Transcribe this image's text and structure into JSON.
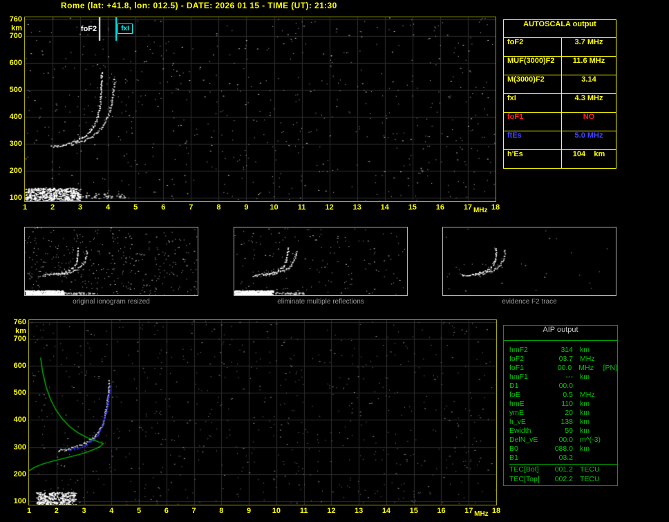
{
  "title": "Rome (lat: +41.8, lon: 012.5) - DATE: 2026 01 15 - TIME (UT): 21:30",
  "colors": {
    "background": "#000000",
    "title": "#ffff00",
    "plot_border": "#a8a800",
    "grid": "#2e2e2e",
    "axis": "#ffff00",
    "yellow": "#ffff00",
    "red": "#ff2222",
    "blue": "#4444ff",
    "cyan": "#00ffff",
    "trace_white": "#ffffff",
    "trace_blue": "#3232ff",
    "profile_green": "#00b400",
    "autoscala_border": "#ffff00",
    "aip_border": "#00a000",
    "aip_text": "#00cc00",
    "aip_title": "#c8c8c8",
    "caption": "#9a9a9a",
    "thumb_border": "#b4b4b4"
  },
  "autoscala_table": {
    "title": "AUTOSCALA output",
    "rows": [
      {
        "label": "foF2",
        "value": "3.7 MHz",
        "color": "yellow"
      },
      {
        "label": "MUF(3000)F2",
        "value": "11.6 MHz",
        "color": "yellow"
      },
      {
        "label": "M(3000)F2",
        "value": "3.14",
        "color": "yellow"
      },
      {
        "label": "fxI",
        "value": "4.3 MHz",
        "color": "yellow"
      },
      {
        "label": "foF1",
        "value": "NO",
        "color": "red"
      },
      {
        "label": "ftEs",
        "value": "5.0 MHz",
        "color": "blue"
      },
      {
        "label": "h'Es",
        "value": "104    km",
        "color": "yellow"
      }
    ]
  },
  "aip_table": {
    "title": "AIP output",
    "rows": [
      {
        "name": "hmF2",
        "value": "314",
        "unit": "km",
        "extra": ""
      },
      {
        "name": "foF2",
        "value": "03.7",
        "unit": "MHz",
        "extra": ""
      },
      {
        "name": "foF1",
        "value": "00.0",
        "unit": "MHz",
        "extra": "[PN]"
      },
      {
        "name": "hmF1",
        "value": "---",
        "unit": "km",
        "extra": ""
      },
      {
        "name": "D1",
        "value": "00.0",
        "unit": "",
        "extra": ""
      },
      {
        "name": "foE",
        "value": "0.5",
        "unit": "MHz",
        "extra": ""
      },
      {
        "name": "hmE",
        "value": "110",
        "unit": "km",
        "extra": ""
      },
      {
        "name": "ymE",
        "value": "20",
        "unit": "km",
        "extra": ""
      },
      {
        "name": "h_vE",
        "value": "138",
        "unit": "km",
        "extra": ""
      },
      {
        "name": "Ewidth",
        "value": "59",
        "unit": "km",
        "extra": ""
      },
      {
        "name": "DelN_vE",
        "value": "00.0",
        "unit": "m^(-3)",
        "extra": ""
      },
      {
        "name": "B0",
        "value": "088.0",
        "unit": "km",
        "extra": ""
      },
      {
        "name": "B1",
        "value": "03.2",
        "unit": "",
        "extra": ""
      },
      {
        "name": "TEC[Bot]",
        "value": "001.2",
        "unit": "TECU",
        "extra": "",
        "separator": true
      },
      {
        "name": "TEC[Top]",
        "value": "002.2",
        "unit": "TECU",
        "extra": ""
      }
    ]
  },
  "thumbnails": [
    {
      "caption": "original ionogram resized",
      "noise_count": 360,
      "show_es": true
    },
    {
      "caption": "eliminate multiple reflections",
      "noise_count": 160,
      "show_es": true
    },
    {
      "caption": "evidence F2 trace",
      "noise_count": 28,
      "show_es": false
    }
  ],
  "chart_data": [
    {
      "id": "autoscaled_ionogram",
      "type": "scatter",
      "xlabel": "MHz",
      "ylabel": "km",
      "xlim": [
        1,
        18
      ],
      "ylim": [
        100,
        760
      ],
      "xticks": [
        1,
        2,
        3,
        4,
        5,
        6,
        7,
        8,
        9,
        10,
        11,
        12,
        13,
        14,
        15,
        16,
        17,
        18
      ],
      "yticks": [
        760,
        700,
        600,
        500,
        400,
        300,
        200,
        100
      ],
      "grid": true,
      "markers": [
        {
          "label": "foF2",
          "x": 3.7,
          "color": "#ffffff",
          "boxed": false
        },
        {
          "label": "fxI",
          "x": 4.3,
          "color": "#00ffff",
          "boxed": true
        }
      ],
      "series": [
        {
          "name": "F2 ordinary trace",
          "kind": "trace",
          "color": "#ffffff",
          "points": [
            [
              1.95,
              291
            ],
            [
              2.15,
              294
            ],
            [
              2.4,
              299
            ],
            [
              2.65,
              306
            ],
            [
              2.9,
              315
            ],
            [
              3.1,
              327
            ],
            [
              3.3,
              343
            ],
            [
              3.45,
              362
            ],
            [
              3.57,
              386
            ],
            [
              3.65,
              415
            ],
            [
              3.7,
              450
            ],
            [
              3.73,
              490
            ],
            [
              3.75,
              532
            ],
            [
              3.76,
              572
            ]
          ]
        },
        {
          "name": "F2 extraordinary trace",
          "kind": "trace",
          "color": "#e0e0e0",
          "points": [
            [
              2.65,
              299
            ],
            [
              2.9,
              305
            ],
            [
              3.15,
              314
            ],
            [
              3.4,
              327
            ],
            [
              3.6,
              343
            ],
            [
              3.78,
              363
            ],
            [
              3.93,
              390
            ],
            [
              4.05,
              422
            ],
            [
              4.13,
              460
            ],
            [
              4.19,
              505
            ],
            [
              4.22,
              548
            ]
          ]
        },
        {
          "name": "Es layer",
          "kind": "band",
          "x1": 1.0,
          "x2": 3.0,
          "y": 112,
          "thickness": 20,
          "density": 520,
          "color": "#ffffff"
        },
        {
          "name": "Es tail",
          "kind": "band",
          "x1": 3.0,
          "x2": 4.6,
          "y": 110,
          "thickness": 8,
          "density": 45,
          "color": "#cccccc"
        }
      ],
      "noise": {
        "count": 650,
        "color": "#c8c8c8",
        "seed": 13
      }
    },
    {
      "id": "profile_ionogram",
      "type": "scatter",
      "xlabel": "MHz",
      "ylabel": "km",
      "xlim": [
        1,
        18
      ],
      "ylim": [
        100,
        760
      ],
      "xticks": [
        1,
        2,
        3,
        4,
        5,
        6,
        7,
        8,
        9,
        10,
        11,
        12,
        13,
        14,
        15,
        16,
        17,
        18
      ],
      "yticks": [
        760,
        700,
        600,
        500,
        400,
        300,
        200,
        100
      ],
      "grid": true,
      "markers": [],
      "series": [
        {
          "name": "measured F2 trace",
          "kind": "trace",
          "color": "#e8e8e8",
          "points": [
            [
              2.05,
              289
            ],
            [
              2.3,
              293
            ],
            [
              2.55,
              299
            ],
            [
              2.8,
              307
            ],
            [
              3.05,
              318
            ],
            [
              3.3,
              334
            ],
            [
              3.5,
              356
            ],
            [
              3.65,
              383
            ],
            [
              3.75,
              417
            ],
            [
              3.82,
              458
            ],
            [
              3.87,
              505
            ],
            [
              3.9,
              550
            ]
          ]
        },
        {
          "name": "restored trace",
          "kind": "trace",
          "color": "#3232ff",
          "points": [
            [
              2.45,
              291
            ],
            [
              2.7,
              297
            ],
            [
              2.95,
              306
            ],
            [
              3.2,
              319
            ],
            [
              3.4,
              337
            ],
            [
              3.57,
              362
            ],
            [
              3.7,
              395
            ],
            [
              3.8,
              437
            ],
            [
              3.88,
              485
            ],
            [
              3.93,
              530
            ]
          ]
        },
        {
          "name": "electron density profile",
          "kind": "line",
          "color": "#00b400",
          "points": [
            [
              1.42,
              630
            ],
            [
              1.5,
              575
            ],
            [
              1.62,
              523
            ],
            [
              1.78,
              477
            ],
            [
              1.98,
              437
            ],
            [
              2.22,
              403
            ],
            [
              2.5,
              374
            ],
            [
              2.8,
              352
            ],
            [
              3.1,
              336
            ],
            [
              3.38,
              325
            ],
            [
              3.6,
              317
            ],
            [
              3.7,
              314
            ],
            [
              3.62,
              305
            ],
            [
              3.45,
              295
            ],
            [
              3.2,
              285
            ],
            [
              2.9,
              275
            ],
            [
              2.55,
              266
            ],
            [
              2.2,
              257
            ],
            [
              1.85,
              248
            ],
            [
              1.5,
              238
            ],
            [
              1.2,
              226
            ],
            [
              1.0,
              213
            ]
          ]
        },
        {
          "name": "Es layer",
          "kind": "band",
          "x1": 1.25,
          "x2": 2.7,
          "y": 112,
          "thickness": 18,
          "density": 300,
          "color": "#ffffff"
        }
      ],
      "noise": {
        "count": 750,
        "color": "#909090",
        "seed": 29
      }
    }
  ]
}
